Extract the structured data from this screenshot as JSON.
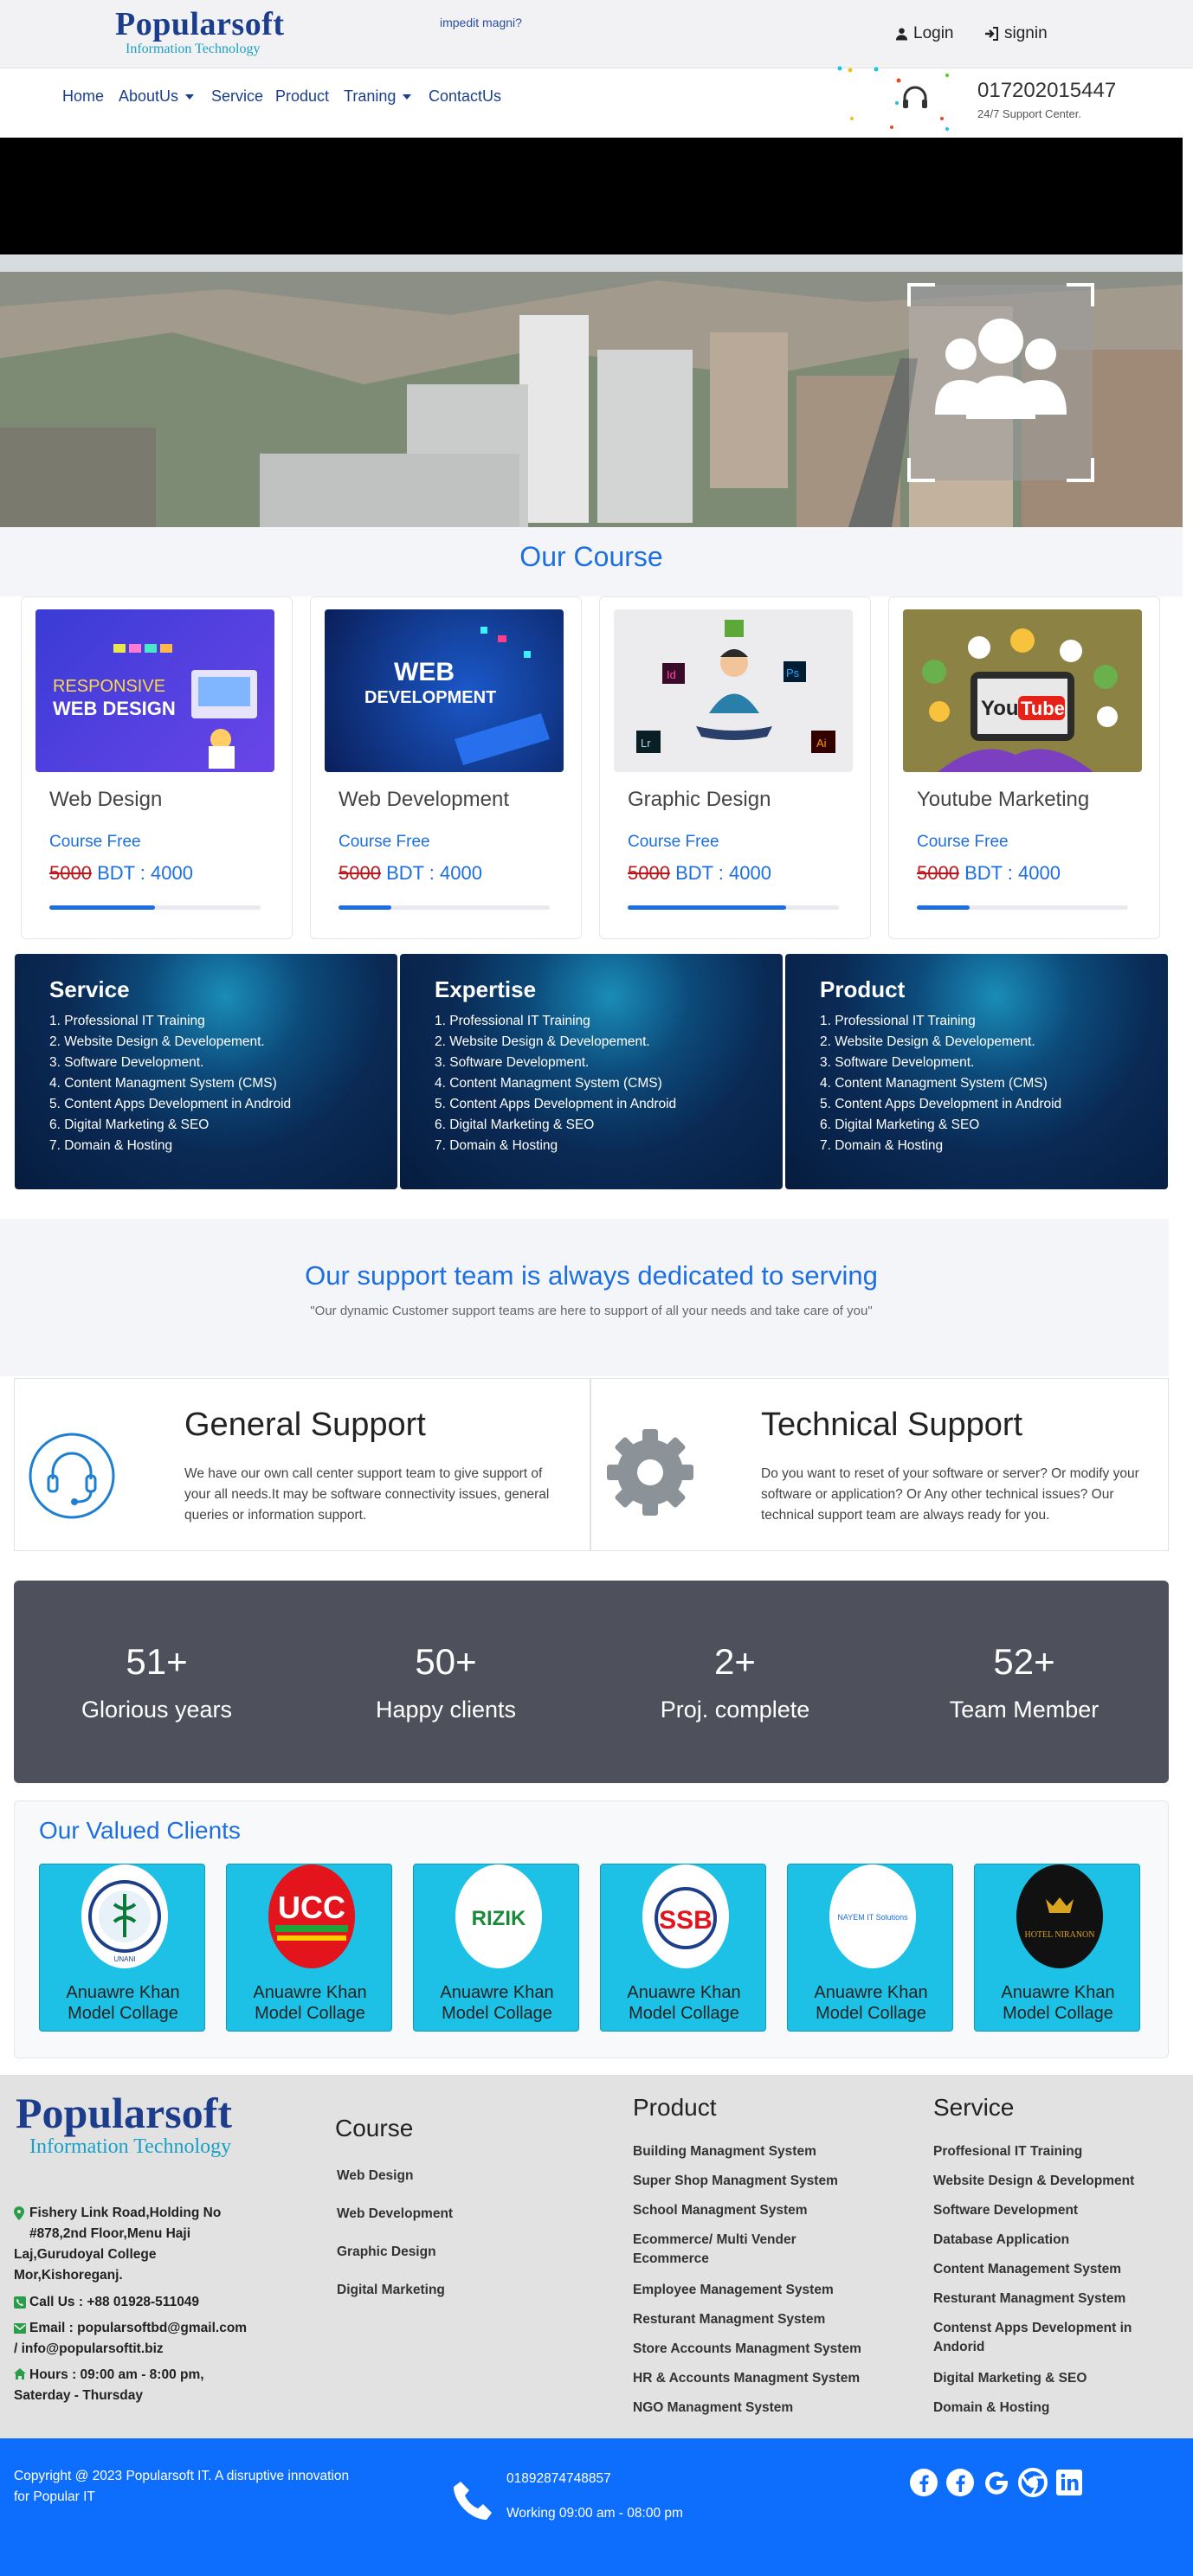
{
  "brand": {
    "name": "Popularsoft",
    "tagline": "Information Technology"
  },
  "topbar": {
    "marquee": "impedit magni?",
    "login": "Login",
    "signin": "signin"
  },
  "nav": {
    "items": [
      "Home",
      "AboutUs",
      "Service",
      "Product",
      "Traning",
      "ContactUs"
    ],
    "phone": "017202015447",
    "phone_sub": "24/7 Support Center."
  },
  "course": {
    "title": "Our Course",
    "cards": [
      {
        "title": "Web Design",
        "free": "Course Free",
        "old": "5000",
        "price": "BDT : 4000",
        "progress": 0.5,
        "banner": [
          "RESPONSIVE",
          "WEB DESIGN"
        ]
      },
      {
        "title": "Web Development",
        "free": "Course Free",
        "old": "5000",
        "price": "BDT : 4000",
        "progress": 0.25,
        "banner": [
          "WEB",
          "DEVELOPMENT"
        ]
      },
      {
        "title": "Graphic Design",
        "free": "Course Free",
        "old": "5000",
        "price": "BDT : 4000",
        "progress": 0.75,
        "banner": [
          "Id",
          "Ps",
          "Lr",
          "Ai"
        ]
      },
      {
        "title": "Youtube Marketing",
        "free": "Course Free",
        "old": "5000",
        "price": "BDT : 4000",
        "progress": 0.25,
        "banner": [
          "You",
          "Tube"
        ]
      }
    ]
  },
  "panels": [
    {
      "title": "Service",
      "items": [
        "1. Professional IT Training",
        "2. Website Design & Developement.",
        "3. Software Development.",
        "4. Content Managment System (CMS)",
        "5. Content Apps Development in Android",
        "6. Digital Marketing & SEO",
        "7. Domain & Hosting"
      ]
    },
    {
      "title": "Expertise",
      "items": [
        "1. Professional IT Training",
        "2. Website Design & Developement.",
        "3. Software Development.",
        "4. Content Managment System (CMS)",
        "5. Content Apps Development in Android",
        "6. Digital Marketing & SEO",
        "7. Domain & Hosting"
      ]
    },
    {
      "title": "Product",
      "items": [
        "1. Professional IT Training",
        "2. Website Design & Developement.",
        "3. Software Development.",
        "4. Content Managment System (CMS)",
        "5. Content Apps Development in Android",
        "6. Digital Marketing & SEO",
        "7. Domain & Hosting"
      ]
    }
  ],
  "support": {
    "title": "Our support team is always dedicated to serving",
    "subtitle": "\"Our dynamic Customer support teams are here to support of all your needs and take care of you\"",
    "general": {
      "title": "General Support",
      "text": "We have our own call center support team to give support of your all needs.It may be software connectivity issues, general queries or information support."
    },
    "technical": {
      "title": "Technical Support",
      "text": "Do you want to reset of your software or server? Or modify your software or application? Or Any other technical issues? Our technical support team are always ready for you."
    }
  },
  "stats": [
    {
      "num": "51+",
      "label": "Glorious years"
    },
    {
      "num": "50+",
      "label": "Happy clients"
    },
    {
      "num": "2+",
      "label": "Proj. complete"
    },
    {
      "num": "52+",
      "label": "Team Member"
    }
  ],
  "clients": {
    "title": "Our Valued Clients",
    "items": [
      {
        "name1": "Anuawre Khan",
        "name2": "Model Collage",
        "logo": "UNANI"
      },
      {
        "name1": "Anuawre Khan",
        "name2": "Model Collage",
        "logo": "UCC"
      },
      {
        "name1": "Anuawre Khan",
        "name2": "Model Collage",
        "logo": "RIZIK"
      },
      {
        "name1": "Anuawre Khan",
        "name2": "Model Collage",
        "logo": "SSB"
      },
      {
        "name1": "Anuawre Khan",
        "name2": "Model Collage",
        "logo": "NAYEM IT Solutions"
      },
      {
        "name1": "Anuawre Khan",
        "name2": "Model Collage",
        "logo": "HOTEL NIRANON"
      }
    ]
  },
  "footer": {
    "address": [
      "Fishery Link Road,Holding No",
      "#878,2nd Floor,Menu Haji",
      "Laj,Gurudoyal College",
      "Mor,Kishoreganj."
    ],
    "call": "Call Us : +88 01928-511049",
    "email": [
      "Email : popularsoftbd@gmail.com",
      "/ info@popularsoftit.biz"
    ],
    "hours": [
      "Hours : 09:00 am - 8:00 pm,",
      "Saterday - Thursday"
    ],
    "course_title": "Course",
    "course": [
      "Web Design",
      "Web Development",
      "Graphic Design",
      "Digital Marketing"
    ],
    "product_title": "Product",
    "product": [
      "Building Managment System",
      "Super Shop Managment System",
      "School Managment System",
      "Ecommerce/ Multi Vender",
      "Ecommerce",
      "Employee Management System",
      "Resturant Managment System",
      "Store Accounts Managment System",
      "HR & Accounts Managment System",
      "NGO Managment System"
    ],
    "service_title": "Service",
    "service": [
      "Proffesional IT Training",
      "Website Design & Development",
      "Software Development",
      "Database Application",
      "Content Management System",
      "Resturant Managment System",
      "Contenst Apps Development in",
      "Andorid",
      "Digital Marketing & SEO",
      "Domain & Hosting"
    ]
  },
  "bottom": {
    "copy1": "Copyright @ 2023 Popularsoft IT. A disruptive innovation",
    "copy2": "for Popular IT",
    "phone": "01892874748857",
    "hours": "Working 09:00 am - 08:00 pm"
  },
  "colors": {
    "primary": "#1d6fe0",
    "footer_bar": "#0d6efd",
    "stats_bg": "#4e515c",
    "client_bg": "#1dc1e6"
  }
}
